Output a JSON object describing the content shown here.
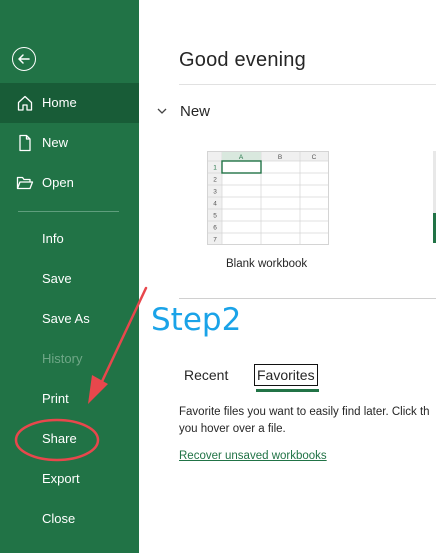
{
  "sidebar": {
    "back_label": "",
    "items": [
      {
        "label": "Home"
      },
      {
        "label": "New"
      },
      {
        "label": "Open"
      },
      {
        "label": "Info"
      },
      {
        "label": "Save"
      },
      {
        "label": "Save As"
      },
      {
        "label": "History"
      },
      {
        "label": "Print"
      },
      {
        "label": "Share"
      },
      {
        "label": "Export"
      },
      {
        "label": "Close"
      }
    ]
  },
  "main": {
    "greeting": "Good evening",
    "new_section_label": "New",
    "template_label": "Blank workbook",
    "template_columns": [
      "A",
      "B",
      "C"
    ],
    "template_rows": [
      "1",
      "2",
      "3",
      "4",
      "5",
      "6",
      "7"
    ],
    "tabs": [
      {
        "label": "Recent"
      },
      {
        "label": "Favorites"
      }
    ],
    "favorites_text_line1": "Favorite files you want to easily find later. Click th",
    "favorites_text_line2": "you hover over a file.",
    "recover_link": "Recover unsaved workbooks"
  },
  "annotation": {
    "step_label": "Step2",
    "color": "#e8474c"
  },
  "colors": {
    "accent": "#217346",
    "accent_dark": "#185c37",
    "step_blue": "#1aa3e8"
  }
}
